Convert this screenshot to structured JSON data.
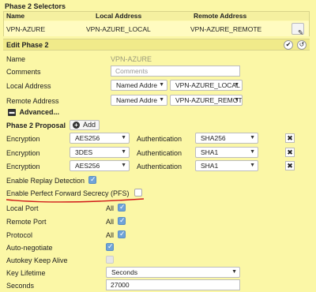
{
  "selectors": {
    "title": "Phase 2 Selectors",
    "headers": [
      "Name",
      "Local Address",
      "Remote Address"
    ],
    "row": {
      "name": "VPN-AZURE",
      "local": "VPN-AZURE_LOCAL",
      "remote": "VPN-AZURE_REMOTE"
    }
  },
  "edit": {
    "title": "Edit Phase 2",
    "name_label": "Name",
    "name_value": "VPN-AZURE",
    "comments_label": "Comments",
    "comments_placeholder": "Comments",
    "local_label": "Local Address",
    "local_type": "Named Addre",
    "local_value": "VPN-AZURE_LOCAL",
    "remote_label": "Remote Address",
    "remote_type": "Named Addre",
    "remote_value": "VPN-AZURE_REMOTI",
    "advanced_label": "Advanced..."
  },
  "proposal": {
    "title": "Phase 2 Proposal",
    "add_label": "Add",
    "rows": [
      {
        "enc_label": "Encryption",
        "enc": "AES256",
        "auth_label": "Authentication",
        "auth": "SHA256"
      },
      {
        "enc_label": "Encryption",
        "enc": "3DES",
        "auth_label": "Authentication",
        "auth": "SHA1"
      },
      {
        "enc_label": "Encryption",
        "enc": "AES256",
        "auth_label": "Authentication",
        "auth": "SHA1"
      }
    ]
  },
  "options": {
    "replay_label": "Enable Replay Detection",
    "replay_checked": true,
    "pfs_label": "Enable Perfect Forward Secrecy (PFS)",
    "pfs_checked": false,
    "local_port_label": "Local Port",
    "remote_port_label": "Remote Port",
    "protocol_label": "Protocol",
    "all_label": "All",
    "auto_negotiate_label": "Auto-negotiate",
    "autokey_label": "Autokey Keep Alive",
    "key_lifetime_label": "Key Lifetime",
    "key_lifetime_value": "Seconds",
    "seconds_label": "Seconds",
    "seconds_value": "27000"
  },
  "colors": {
    "panel_bg": "#fbf7a6",
    "header_bg": "#f0ea8a",
    "check_on": "#6fa3d8",
    "annotation_red": "#d01818"
  }
}
